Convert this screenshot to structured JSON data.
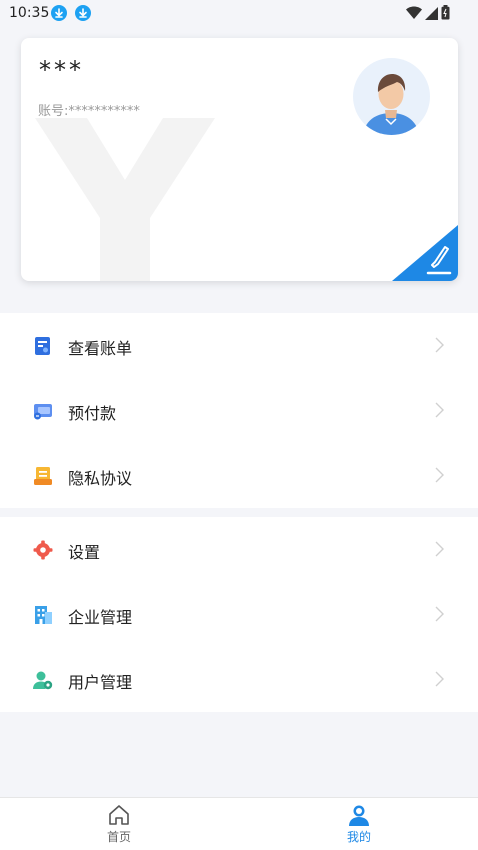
{
  "status_bar": {
    "time": "10:35",
    "icons": [
      "download-icon",
      "download-icon",
      "wifi-icon",
      "signal-icon",
      "battery-icon"
    ]
  },
  "profile": {
    "name": "***",
    "account_label": "账号:",
    "account_value": "***********",
    "watermark_letter": "Y"
  },
  "menu_groups": [
    {
      "items": [
        {
          "label": "查看账单",
          "icon": "bill-icon"
        },
        {
          "label": "预付款",
          "icon": "prepay-card-icon"
        },
        {
          "label": "隐私协议",
          "icon": "privacy-icon"
        }
      ]
    },
    {
      "items": [
        {
          "label": "设置",
          "icon": "settings-gear-icon"
        },
        {
          "label": "企业管理",
          "icon": "enterprise-building-icon"
        },
        {
          "label": "用户管理",
          "icon": "user-manage-icon"
        }
      ]
    }
  ],
  "bottom_nav": {
    "tabs": [
      {
        "label": "首页",
        "icon": "home-icon",
        "active": false
      },
      {
        "label": "我的",
        "icon": "profile-icon",
        "active": true
      }
    ]
  },
  "colors": {
    "accent": "#1e88e5",
    "background": "#f4f5f9"
  }
}
